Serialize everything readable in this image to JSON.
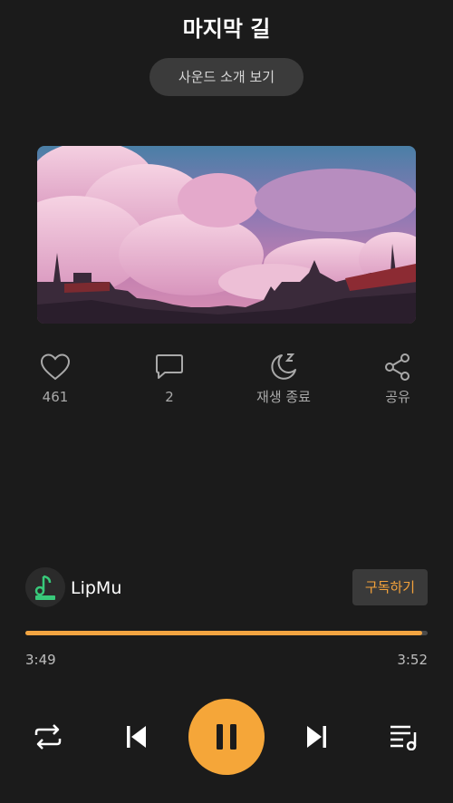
{
  "header": {
    "title": "마지막 길",
    "intro_button_label": "사운드 소개 보기"
  },
  "cover": {
    "description_icon": "cover-art-image"
  },
  "actions": [
    {
      "icon": "heart-icon",
      "label": "461"
    },
    {
      "icon": "comment-icon",
      "label": "2"
    },
    {
      "icon": "moon-sleep-icon",
      "label": "재생 종료"
    },
    {
      "icon": "share-icon",
      "label": "공유"
    }
  ],
  "artist": {
    "name": "LipMu",
    "subscribe_label": "구독하기",
    "avatar_icon": "lipmu-logo-icon"
  },
  "player": {
    "current_time": "3:49",
    "total_time": "3:52",
    "progress": 0.987,
    "controls": [
      "repeat-icon",
      "previous-icon",
      "pause-icon",
      "next-icon",
      "playlist-icon"
    ]
  },
  "colors": {
    "accent": "#f5a639",
    "background": "#1b1b1b",
    "chip": "#3b3b3b"
  }
}
